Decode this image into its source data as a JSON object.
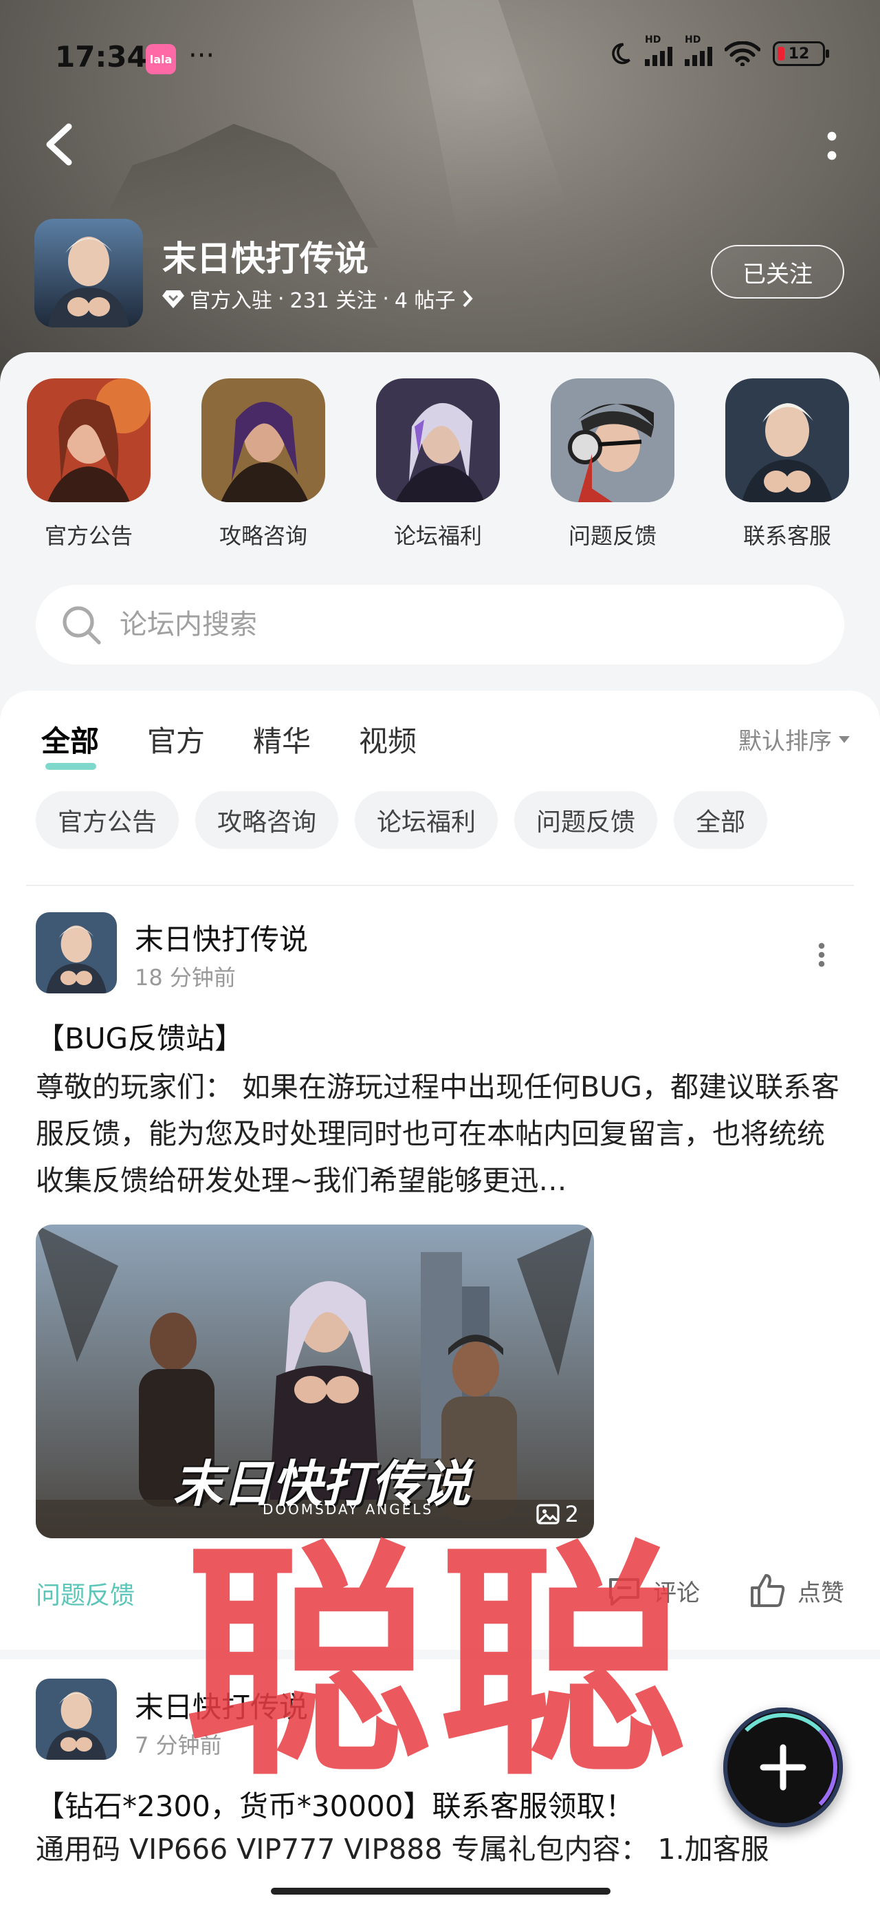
{
  "status_bar": {
    "time": "17:34",
    "app_badge": "lala",
    "more": "···",
    "battery": "12"
  },
  "forum": {
    "title": "末日快打传说",
    "meta_official": "官方入驻",
    "meta_follows": "231 关注",
    "meta_posts": "4 帖子",
    "follow_label": "已关注"
  },
  "quick_links": [
    {
      "label": "官方公告"
    },
    {
      "label": "攻略咨询"
    },
    {
      "label": "论坛福利"
    },
    {
      "label": "问题反馈"
    },
    {
      "label": "联系客服"
    }
  ],
  "search": {
    "placeholder": "论坛内搜索"
  },
  "tabs": [
    "全部",
    "官方",
    "精华",
    "视频"
  ],
  "sort_label": "默认排序",
  "chips": [
    "官方公告",
    "攻略咨询",
    "论坛福利",
    "问题反馈",
    "全部"
  ],
  "posts": [
    {
      "author": "末日快打传说",
      "time": "18 分钟前",
      "title": "【BUG反馈站】",
      "body": "尊敬的玩家们：  如果在游玩过程中出现任何BUG，都建议联系客服反馈，能为您及时处理同时也可在本帖内回复留言，也将统统收集反馈给研发处理~我们希望能够更迅…",
      "image_logo_text": "末日快打传说",
      "image_logo_sub": "DOOMSDAY ANGELS",
      "image_count": "2",
      "tag": "问题反馈",
      "comment_label": "评论",
      "like_label": "点赞"
    },
    {
      "author": "末日快打传说",
      "time": "7 分钟前",
      "title": "【钻石*2300，货币*30000】联系客服领取！",
      "body": "通用码 VIP666 VIP777 VIP888 专属礼包内容：  1.加客服"
    }
  ],
  "watermark": "聪聪",
  "colors": {
    "accent": "#5cc7b9",
    "tab_underline": "#7fd8cc",
    "watermark": "#e83c42"
  }
}
